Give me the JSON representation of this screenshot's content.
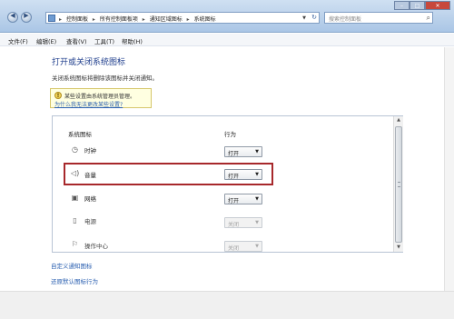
{
  "address_bar": {
    "crumbs": [
      "控制面板",
      "所有控制面板项",
      "通知区域图标",
      "系统图标"
    ]
  },
  "search": {
    "placeholder": "搜索控制面板"
  },
  "menu": [
    "文件(F)",
    "编辑(E)",
    "查看(V)",
    "工具(T)",
    "帮助(H)"
  ],
  "page": {
    "title": "打开或关闭系统图标",
    "description": "关闭系统图标将删除该图标并关闭通知。"
  },
  "notice": {
    "text": "某些设置由系统管理员管理。",
    "link": "为什么我无法更改某些设置?"
  },
  "table": {
    "col_icon": "系统图标",
    "col_behavior": "行为",
    "rows": [
      {
        "icon": "clock-icon",
        "label": "时钟",
        "value": "打开",
        "enabled": true
      },
      {
        "icon": "volume-icon",
        "label": "音量",
        "value": "打开",
        "enabled": true
      },
      {
        "icon": "network-icon",
        "label": "网络",
        "value": "打开",
        "enabled": true
      },
      {
        "icon": "power-icon",
        "label": "电源",
        "value": "关闭",
        "enabled": false
      },
      {
        "icon": "flag-icon",
        "label": "操作中心",
        "value": "关闭",
        "enabled": false
      }
    ]
  },
  "links": {
    "customize": "自定义通知图标",
    "restore": "还原默认图标行为"
  },
  "colors": {
    "heading": "#1e3d8c",
    "link": "#2a5fb0",
    "highlight_border": "#a7282b",
    "notice_bg": "#ffffe1"
  }
}
